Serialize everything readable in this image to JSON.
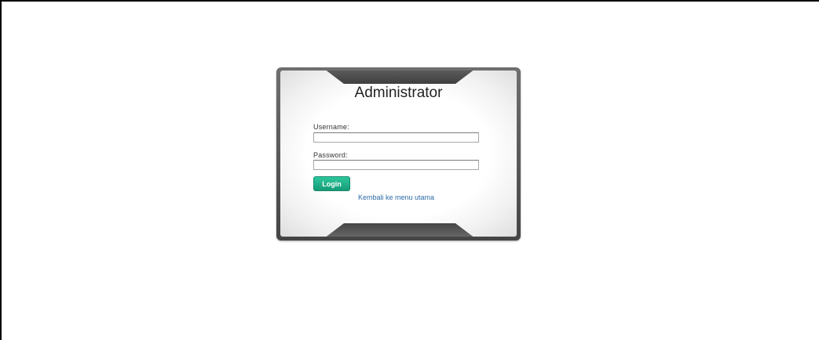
{
  "login": {
    "title": "Administrator",
    "username_label": "Username:",
    "username_value": "",
    "password_label": "Password:",
    "password_value": "",
    "login_button": "Login",
    "back_link": "Kembali ke menu utama"
  },
  "colors": {
    "frame": "#4a4a4a",
    "button": "#1fae88",
    "link": "#2d6aa6"
  }
}
